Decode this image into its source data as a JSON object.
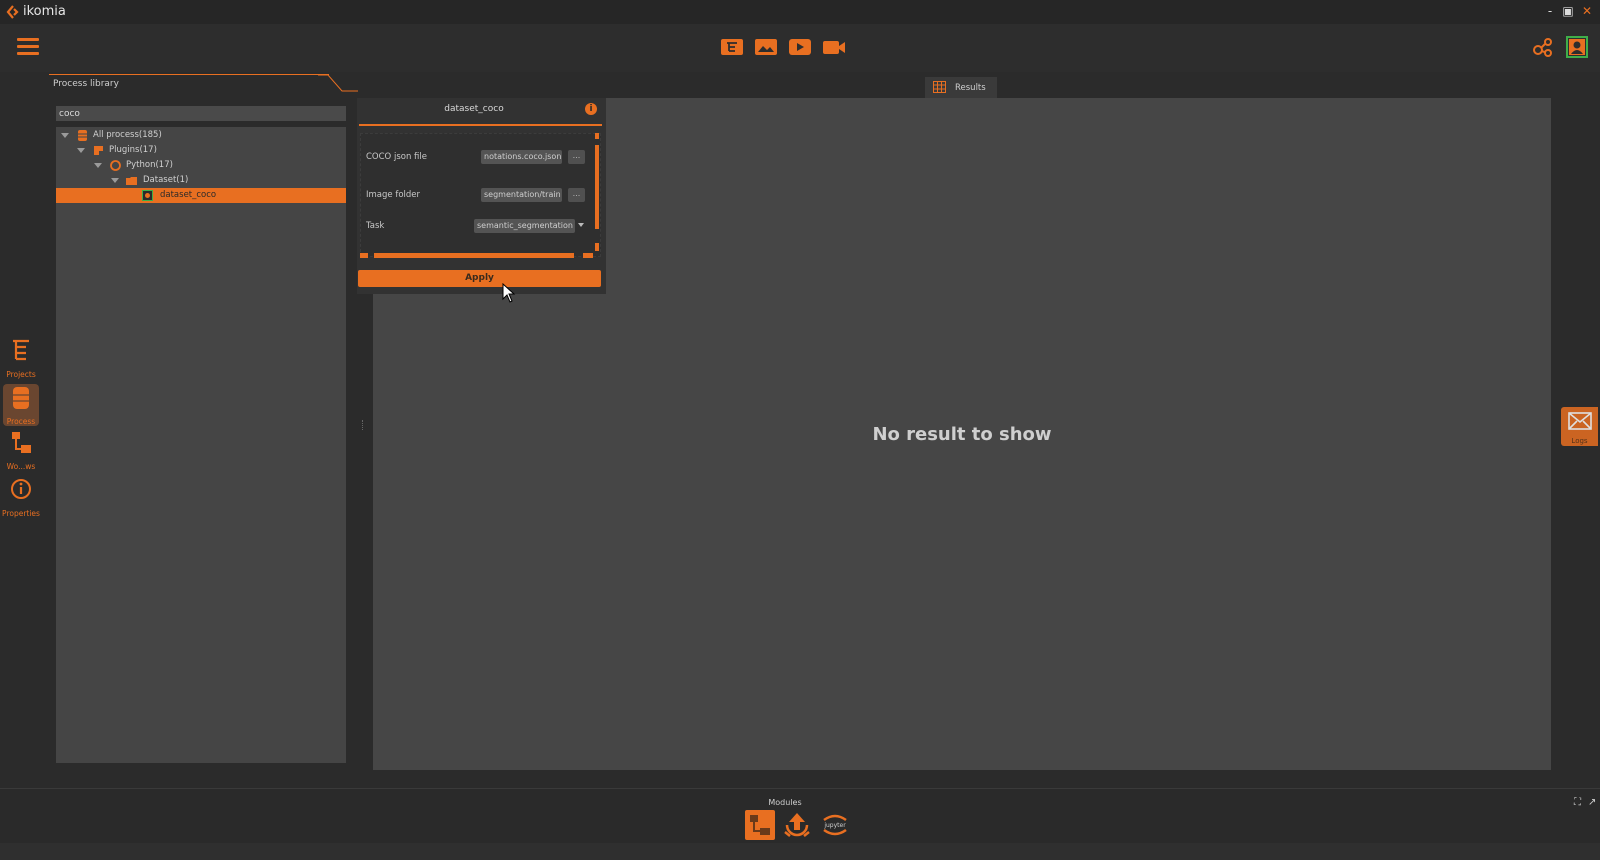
{
  "app": {
    "title": "ikomia",
    "accent": "#e86f21"
  },
  "window_controls": {
    "minimize": "-",
    "maximize": "▣",
    "close": "✕"
  },
  "toolbar": {
    "icons": [
      "hamburger-menu-icon",
      "tree-icon",
      "image-icon",
      "play-icon",
      "video-camera-icon",
      "share-icon",
      "user-icon"
    ]
  },
  "process_library": {
    "tab_label": "Process library",
    "search_value": "coco",
    "tree": [
      {
        "label": "All process(185)",
        "level": 0,
        "icon": "database-icon"
      },
      {
        "label": "Plugins(17)",
        "level": 1,
        "icon": "puzzle-icon"
      },
      {
        "label": "Python(17)",
        "level": 2,
        "icon": "python-icon"
      },
      {
        "label": "Dataset(1)",
        "level": 3,
        "icon": "folder-icon"
      },
      {
        "label": "dataset_coco",
        "level": 4,
        "icon": "process-icon",
        "selected": true
      }
    ]
  },
  "param_panel": {
    "title": "dataset_coco",
    "info": "i",
    "fields": [
      {
        "label": "COCO json file",
        "value": "notations.coco.json",
        "button": "..."
      },
      {
        "label": "Image folder",
        "value": "segmentation/train",
        "button": "..."
      },
      {
        "label": "Task",
        "value": "semantic_segmentation"
      }
    ],
    "apply_label": "Apply"
  },
  "results": {
    "tab_label": "Results",
    "empty_message": "No result to show"
  },
  "sidebar": {
    "items": [
      {
        "label": "Projects",
        "icon": "projects-icon"
      },
      {
        "label": "Process",
        "icon": "process-database-icon",
        "active": true
      },
      {
        "label": "Wo...ws",
        "icon": "workflows-icon"
      },
      {
        "label": "Properties",
        "icon": "info-icon"
      }
    ]
  },
  "logs": {
    "label": "Logs"
  },
  "modules": {
    "label": "Modules",
    "items": [
      "workflow-module-icon",
      "deploy-module-icon",
      "jupyter-icon"
    ]
  },
  "bottom_controls": {
    "expand": "⛶",
    "pop": "↗"
  }
}
